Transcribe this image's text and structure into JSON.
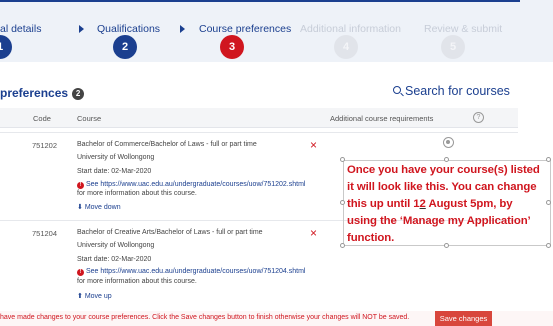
{
  "stepper": {
    "steps": [
      {
        "label": "al details",
        "number": "1"
      },
      {
        "label": "Qualifications",
        "number": "2"
      },
      {
        "label": "Course preferences",
        "number": "3"
      },
      {
        "label": "Additional information",
        "number": "4"
      },
      {
        "label": "Review & submit",
        "number": "5"
      }
    ],
    "colors": {
      "done": "#1b3f8f",
      "current": "#d0161f",
      "upcoming": "#e1e4ea"
    }
  },
  "section": {
    "title": "preferences",
    "count": "2",
    "search_label": "Search for courses"
  },
  "table": {
    "headers": {
      "code": "Code",
      "course": "Course",
      "additional": "Additional course requirements"
    },
    "rows": [
      {
        "code": "751202",
        "course_name": "Bachelor of Commerce/Bachelor of Laws - full or part time",
        "institution": "University of Wollongong",
        "start_date": "Start date: 02-Mar-2020",
        "info_link": "See https://www.uac.edu.au/undergraduate/courses/uow/751202.shtml",
        "info_suffix": "for more information about this course.",
        "move_label": "Move down",
        "move_arrow": "⬇"
      },
      {
        "code": "751204",
        "course_name": "Bachelor of Creative Arts/Bachelor of Laws - full or part time",
        "institution": "University of Wollongong",
        "start_date": "Start date: 02-Mar-2020",
        "info_link": "See https://www.uac.edu.au/undergraduate/courses/uow/751204.shtml",
        "info_suffix": "for more information about this course.",
        "move_label": "Move up",
        "move_arrow": "⬆"
      }
    ],
    "remove_icon": "×"
  },
  "callout": {
    "line1": "Once you have your course(s) listed",
    "line2": "it will look like this. You can change",
    "line3a": "this up until 1",
    "line3b": "2",
    "line3c": " August 5pm, by",
    "line4": "using the ‘Manage my Application’",
    "line5": "function."
  },
  "footer": {
    "message": "have made changes to your course preferences. Click the Save changes button to finish otherwise your changes will NOT be saved.",
    "save_label": "Save changes"
  }
}
